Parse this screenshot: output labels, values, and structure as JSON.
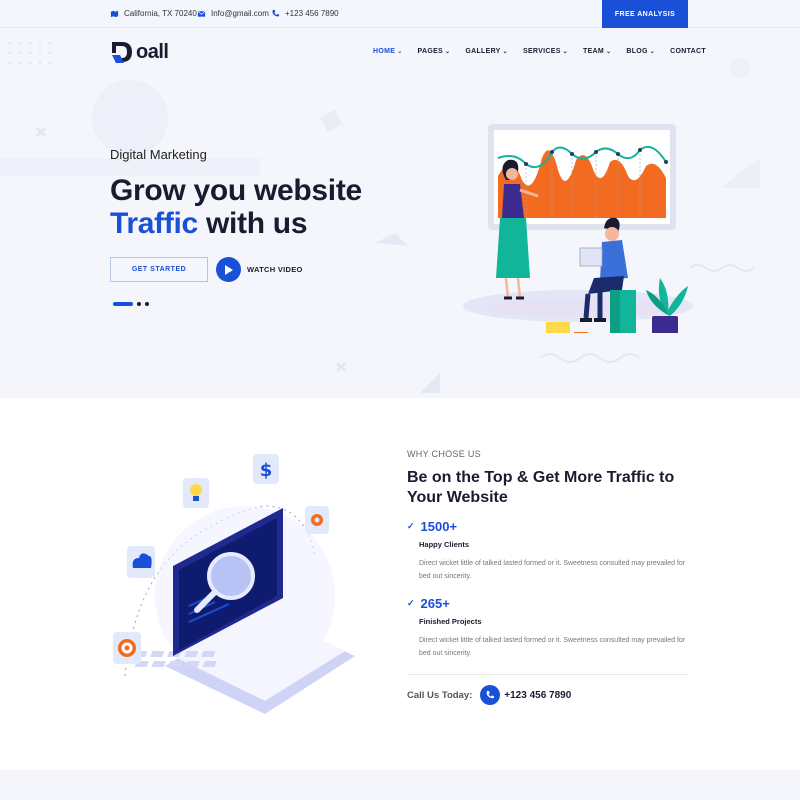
{
  "topbar": {
    "location": "California, TX 70240",
    "email": "Info@gmail.com",
    "phone": "+123 456 7890",
    "cta": "FREE ANALYSIS"
  },
  "brand": {
    "name": "oall"
  },
  "nav": {
    "items": [
      {
        "label": "HOME",
        "dropdown": true,
        "active": true
      },
      {
        "label": "PAGES",
        "dropdown": true
      },
      {
        "label": "GALLERY",
        "dropdown": true
      },
      {
        "label": "SERVICES",
        "dropdown": true
      },
      {
        "label": "TEAM",
        "dropdown": true
      },
      {
        "label": "BLOG",
        "dropdown": true
      },
      {
        "label": "CONTACT",
        "dropdown": false
      }
    ]
  },
  "hero": {
    "eyebrow": "Digital Marketing",
    "headline_line1": "Grow you website",
    "headline_accent": "Traffic",
    "headline_rest": " with us",
    "primary_button": "GET STARTED",
    "video_label": "WATCH VIDEO",
    "slides_total": 3,
    "slide_active": 1
  },
  "why": {
    "eyebrow": "WHY CHOSE US",
    "title": "Be on the Top & Get More Traffic to Your Website",
    "stats": [
      {
        "value": "1500+",
        "label": "Happy Clients",
        "description": "Direct wicket little of talked lasted formed or it. Sweetness consulted may prevailed for bed out sincerity."
      },
      {
        "value": "265+",
        "label": "Finished Projects",
        "description": "Direct wicket little of talked lasted formed or it. Sweetness consulted may prevailed for bed out sincerity."
      }
    ],
    "call_label": "Call Us Today:",
    "call_number": "+123 456 7890"
  },
  "colors": {
    "accent": "#1a4fd8",
    "dark": "#1b1b2f",
    "hero_bg": "#f4f6fc",
    "chart_orange": "#f36b21",
    "chart_teal": "#11b59a"
  },
  "icons": [
    "map-icon",
    "mail-icon",
    "phone-icon",
    "play-icon",
    "check-icon",
    "dollar-icon",
    "bulb-icon",
    "gear-icon",
    "cloud-icon",
    "target-icon",
    "search-icon"
  ]
}
